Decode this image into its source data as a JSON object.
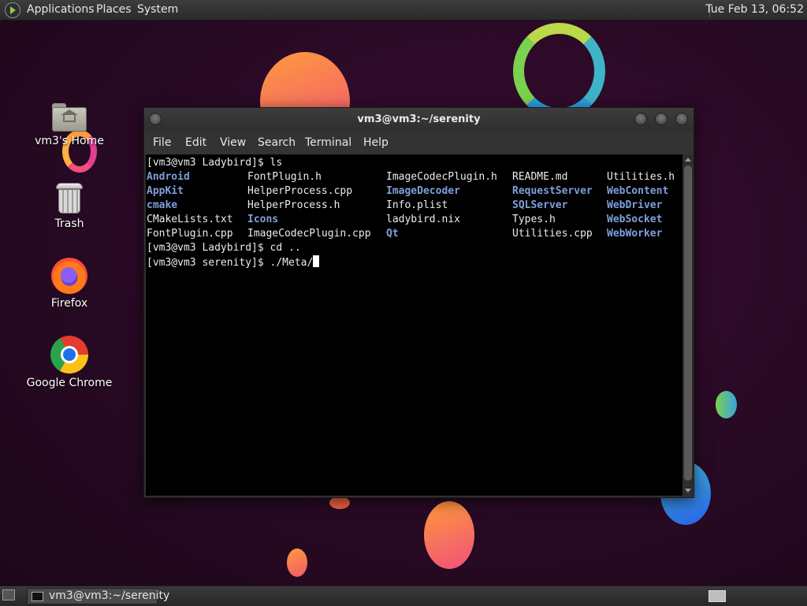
{
  "top_panel": {
    "menus": [
      "Applications",
      "Places",
      "System"
    ],
    "clock": "Tue Feb 13, 06:52"
  },
  "desktop_icons": [
    {
      "label": "vm3's Home",
      "icon": "home-folder-icon"
    },
    {
      "label": "Trash",
      "icon": "trash-icon"
    },
    {
      "label": "Firefox",
      "icon": "firefox-icon"
    },
    {
      "label": "Google Chrome",
      "icon": "chrome-icon"
    }
  ],
  "terminal": {
    "title": "vm3@vm3:~/serenity",
    "menu": [
      "File",
      "Edit",
      "View",
      "Search",
      "Terminal",
      "Help"
    ],
    "colors": {
      "background": "#000000",
      "text": "#ececec",
      "directory": "#7f9fdc"
    },
    "lines": {
      "prompt1": "[vm3@vm3 Ladybird]$ ls",
      "prompt2": "[vm3@vm3 Ladybird]$ cd ..",
      "prompt3": "[vm3@vm3 serenity]$ ./Meta/"
    },
    "ls_columns": [
      [
        {
          "name": "Android",
          "dir": true
        },
        {
          "name": "AppKit",
          "dir": true
        },
        {
          "name": "cmake",
          "dir": true
        },
        {
          "name": "CMakeLists.txt",
          "dir": false
        },
        {
          "name": "FontPlugin.cpp",
          "dir": false
        }
      ],
      [
        {
          "name": "FontPlugin.h",
          "dir": false
        },
        {
          "name": "HelperProcess.cpp",
          "dir": false
        },
        {
          "name": "HelperProcess.h",
          "dir": false
        },
        {
          "name": "Icons",
          "dir": true
        },
        {
          "name": "ImageCodecPlugin.cpp",
          "dir": false
        }
      ],
      [
        {
          "name": "ImageCodecPlugin.h",
          "dir": false
        },
        {
          "name": "ImageDecoder",
          "dir": true
        },
        {
          "name": "Info.plist",
          "dir": false
        },
        {
          "name": "ladybird.nix",
          "dir": false
        },
        {
          "name": "Qt",
          "dir": true
        }
      ],
      [
        {
          "name": "README.md",
          "dir": false
        },
        {
          "name": "RequestServer",
          "dir": true
        },
        {
          "name": "SQLServer",
          "dir": true
        },
        {
          "name": "Types.h",
          "dir": false
        },
        {
          "name": "Utilities.cpp",
          "dir": false
        }
      ],
      [
        {
          "name": "Utilities.h",
          "dir": false
        },
        {
          "name": "WebContent",
          "dir": true
        },
        {
          "name": "WebDriver",
          "dir": true
        },
        {
          "name": "WebSocket",
          "dir": true
        },
        {
          "name": "WebWorker",
          "dir": true
        }
      ]
    ]
  },
  "taskbar": {
    "tasks": [
      {
        "label": "vm3@vm3:~/serenity"
      }
    ]
  }
}
